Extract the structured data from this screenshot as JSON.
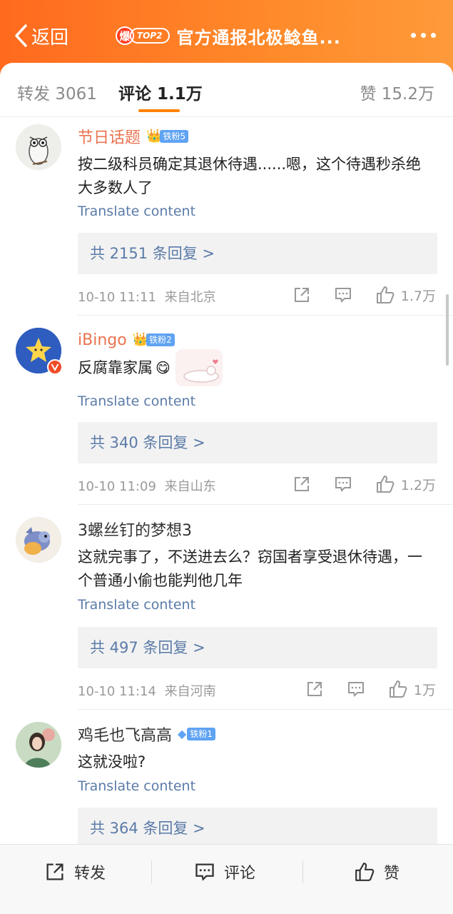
{
  "header": {
    "back_label": "返回",
    "hot_icon_text": "爆",
    "hot_rank_text": "TOP2",
    "title": "官方通报北极鲶鱼...",
    "colors": {
      "start": "#ff6a1e",
      "end": "#ff9a3a"
    }
  },
  "tabs": {
    "repost": "转发 3061",
    "comment": "评论 1.1万",
    "like": "赞 15.2万",
    "accent": "#ff8200"
  },
  "comments": [
    {
      "username": "节日话题",
      "badge": "铁粉5",
      "badge_icon": "crown-icon",
      "text": "按二级科员确定其退休待遇......嗯，这个待遇秒杀绝大多数人了",
      "translate": "Translate content",
      "replies": "共 2151 条回复 >",
      "time": "10-10 11:11",
      "location": "来自北京",
      "likes": "1.7万"
    },
    {
      "username": "iBingo",
      "badge": "铁粉2",
      "badge_icon": "crown-icon",
      "text": "反腐靠家属",
      "translate": "Translate content",
      "replies": "共 340 条回复 >",
      "time": "10-10 11:09",
      "location": "来自山东",
      "likes": "1.2万"
    },
    {
      "username": "3螺丝钉的梦想3",
      "badge": "",
      "text": "这就完事了，不送进去么？窃国者享受退休待遇，一个普通小偷也能判他几年",
      "translate": "Translate content",
      "replies": "共 497 条回复 >",
      "time": "10-10 11:14",
      "location": "来自河南",
      "likes": "1万"
    },
    {
      "username": "鸡毛也飞高高",
      "badge": "铁粉1",
      "badge_icon": "diamond-icon",
      "text": "这就没啦?",
      "translate": "Translate content",
      "replies": "共 364 条回复 >"
    }
  ],
  "bottom_bar": {
    "repost": "转发",
    "comment": "评论",
    "like": "赞"
  }
}
